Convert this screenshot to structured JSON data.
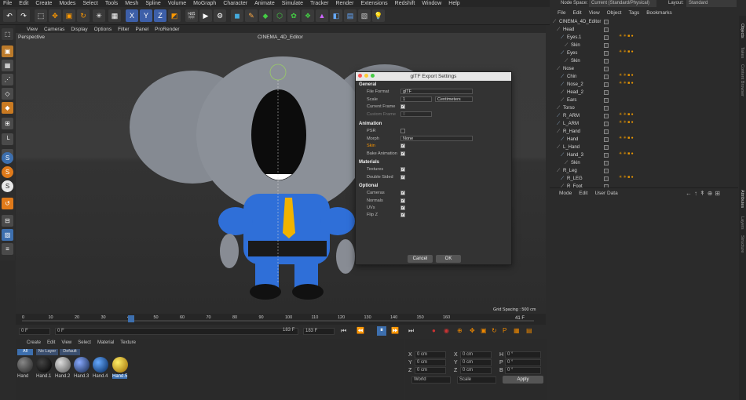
{
  "menu": [
    "File",
    "Edit",
    "Create",
    "Modes",
    "Select",
    "Tools",
    "Mesh",
    "Spline",
    "Volume",
    "MoGraph",
    "Character",
    "Animate",
    "Simulate",
    "Tracker",
    "Render",
    "Extensions",
    "Redshift",
    "Window",
    "Help"
  ],
  "viewport": {
    "menu": [
      "View",
      "Cameras",
      "Display",
      "Options",
      "Filter",
      "Panel",
      "ProRender"
    ],
    "name": "Perspective",
    "title": "CINEMA_4D_Editor",
    "grid": "Grid Spacing : 500 cm"
  },
  "timeline": {
    "ticks": [
      "0",
      "10",
      "20",
      "30",
      "40",
      "50",
      "60",
      "70",
      "80",
      "90",
      "100",
      "110",
      "120",
      "130",
      "140",
      "150",
      "160"
    ],
    "current": "41 F",
    "start": "0 F",
    "start2": "0 F",
    "end": "183 F",
    "end2": "183 F"
  },
  "dialog": {
    "title": "glTF Export Settings",
    "general": "General",
    "file_format_label": "File Format",
    "file_format": "glTF",
    "scale_label": "Scale",
    "scale": "1",
    "units": "Centimeters",
    "current_frame": "Current Frame",
    "custom_frame": "Custom Frame",
    "custom_val": "0",
    "animation": "Animation",
    "psr": "PSR",
    "morph_label": "Morph",
    "morph": "None",
    "skin": "Skin",
    "bake": "Bake Animation",
    "materials": "Materials",
    "textures": "Textures",
    "double_sided": "Double Sided",
    "optional": "Optional",
    "cameras": "Cameras",
    "normals": "Normals",
    "uvs": "UVs",
    "flipz": "Flip Z",
    "cancel": "Cancel",
    "ok": "OK"
  },
  "materials": {
    "menu": [
      "Create",
      "Edit",
      "View",
      "Select",
      "Material",
      "Texture"
    ],
    "filters": [
      "All",
      "No Layer",
      "Default"
    ],
    "items": [
      "Hand",
      "Hand.1",
      "Hand.2",
      "Hand.3",
      "Hand.4",
      "Hand.5"
    ]
  },
  "coords": {
    "x": "X",
    "y": "Y",
    "z": "Z",
    "h": "H",
    "p": "P",
    "b": "B",
    "val": "0 cm",
    "deg": "0 °",
    "world": "World",
    "scale": "Scale",
    "apply": "Apply"
  },
  "right": {
    "nodespace_label": "Node Space:",
    "nodespace": "Current (Standard/Physical)",
    "layout_label": "Layout:",
    "layout": "Standard",
    "menu": [
      "File",
      "Edit",
      "View",
      "Object",
      "Tags",
      "Bookmarks"
    ],
    "attr_menu": [
      "Mode",
      "Edit",
      "User Data"
    ],
    "objects": [
      "CINEMA_4D_Editor",
      "Head",
      "Eyes.1",
      "Skin",
      "Eyes",
      "Skin",
      "Nose",
      "Chin",
      "Nose_2",
      "Head_2",
      "Ears",
      "Torso",
      "R_ARM",
      "L_ARM",
      "R_Hand",
      "Hand",
      "L_Hand",
      "Hand_3",
      "Skin",
      "R_Leg",
      "R_LEG",
      "R_Foot"
    ],
    "tabs": [
      "Objects",
      "Takes",
      "Content Browser",
      "Attributes",
      "Layers",
      "Structure"
    ]
  }
}
